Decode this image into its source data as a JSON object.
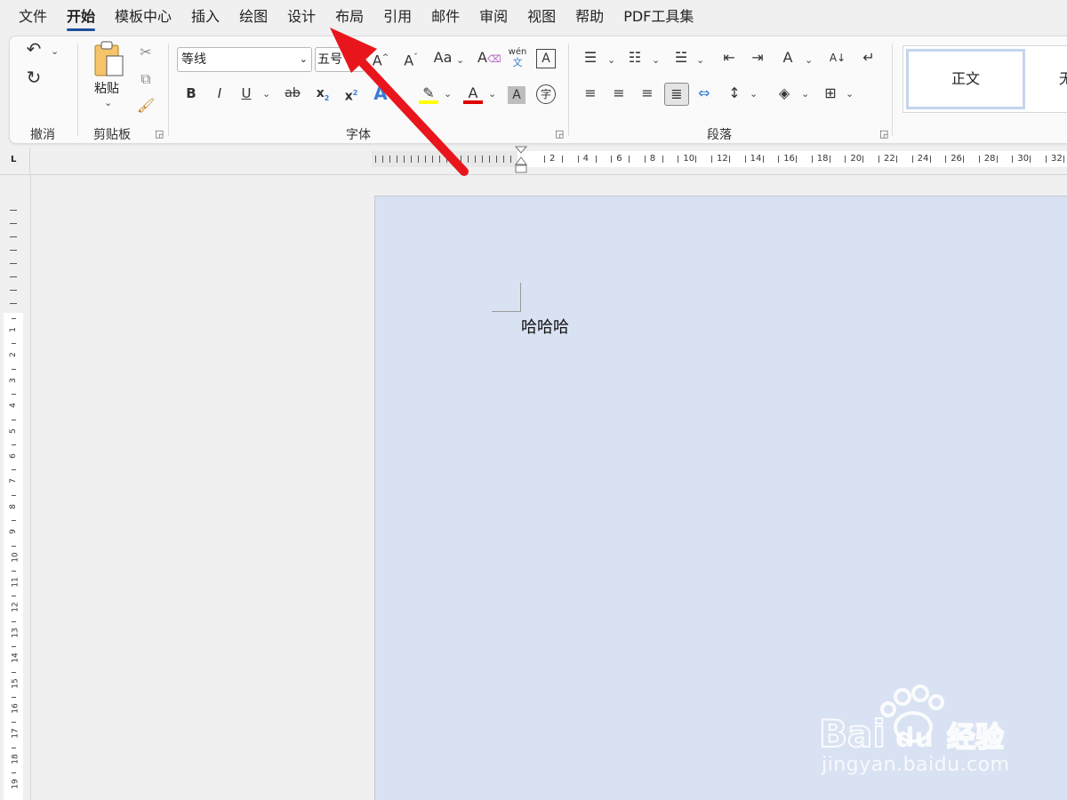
{
  "menu": {
    "tabs": [
      "文件",
      "开始",
      "模板中心",
      "插入",
      "绘图",
      "设计",
      "布局",
      "引用",
      "邮件",
      "审阅",
      "视图",
      "帮助",
      "PDF工具集"
    ],
    "active_tab": "开始"
  },
  "ribbon": {
    "undo_group_label": "撤消",
    "clipboard": {
      "paste_label": "粘贴",
      "group_label": "剪贴板"
    },
    "font": {
      "font_name": "等线",
      "font_size": "五号",
      "group_label": "字体",
      "phonetic_top": "wén",
      "phonetic_bottom": "文",
      "bold": "B",
      "italic": "I",
      "underline": "U",
      "strikethrough": "ab",
      "subscript": "x",
      "superscript": "x",
      "grow": "A",
      "shrink": "A",
      "change_case": "Aa",
      "text_effects": "A",
      "font_color": "A",
      "char_shading": "A",
      "enclose": "字",
      "border": "A"
    },
    "paragraph": {
      "group_label": "段落"
    },
    "styles": {
      "normal": "正文",
      "no_spacing_partial": "无"
    }
  },
  "ruler": {
    "h_numbers": [
      "2",
      "4",
      "6",
      "8",
      "10",
      "12",
      "14",
      "16",
      "18",
      "20",
      "22",
      "24",
      "26",
      "28",
      "30",
      "32"
    ],
    "v_numbers": [
      "1",
      "2",
      "3",
      "4",
      "5",
      "6",
      "7",
      "8",
      "9",
      "10",
      "11",
      "12",
      "13",
      "14",
      "15",
      "16",
      "17",
      "18",
      "19"
    ]
  },
  "document": {
    "text": "哈哈哈"
  },
  "watermark": {
    "text": "jingyan.baidu.com",
    "brand": "经验"
  },
  "colors": {
    "highlight": "#ffff00",
    "font_color": "#e00000",
    "accent": "#1f4e9e",
    "page_bg": "#d9e2f2",
    "arrow": "#e8161c"
  }
}
